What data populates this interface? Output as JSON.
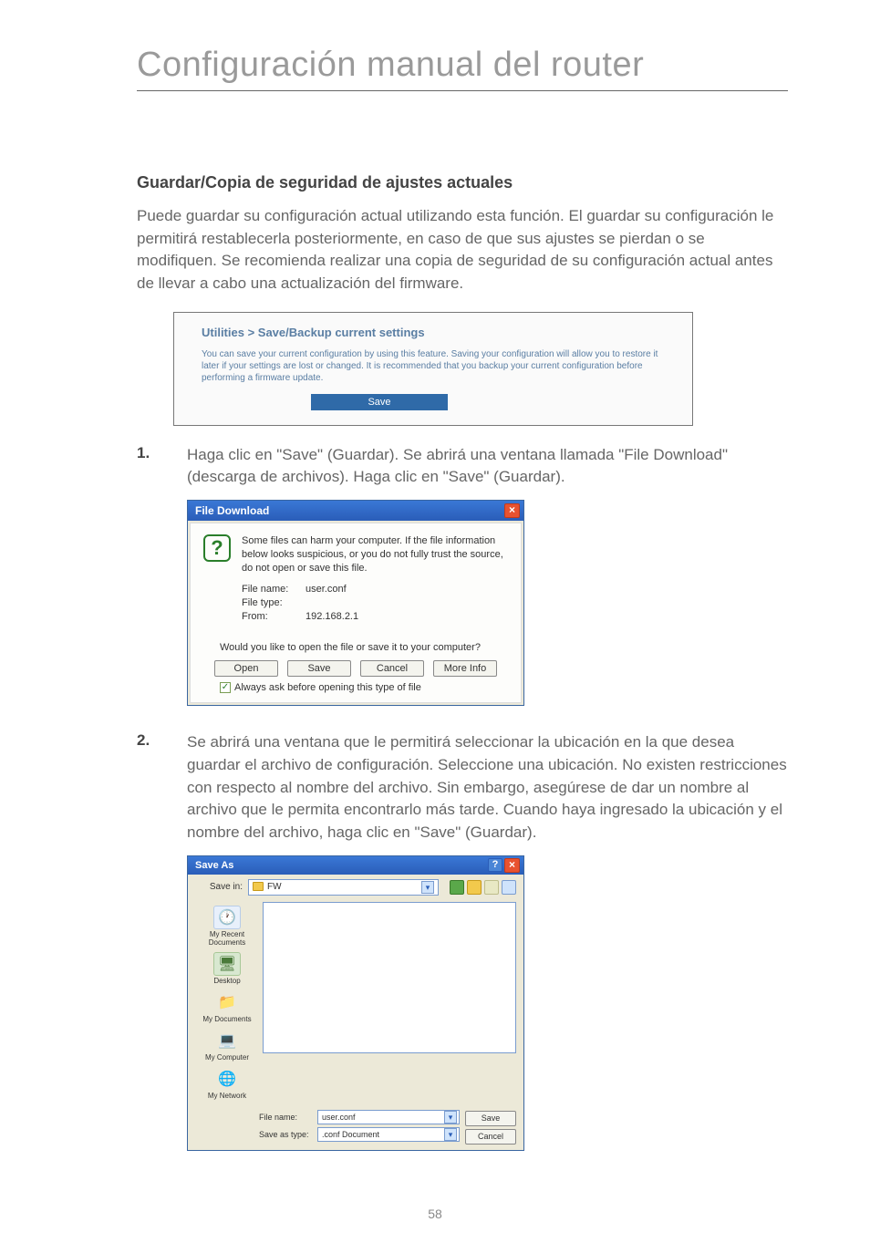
{
  "page_title": "Configuración manual del router",
  "section_heading": "Guardar/Copia de seguridad de ajustes actuales",
  "intro_text": "Puede guardar su configuración actual utilizando esta función. El guardar su configuración le permitirá restablecerla posteriormente, en caso de que sus ajustes se pierdan o se modifiquen. Se recomienda realizar una copia de seguridad de su configuración actual antes de llevar a cabo una actualización del firmware.",
  "router_panel": {
    "title": "Utilities > Save/Backup current settings",
    "description": "You can save your current configuration by using this feature. Saving your configuration will allow you to restore it later if your settings are lost or changed. It is recommended that you backup your current configuration before performing a firmware update.",
    "save_label": "Save"
  },
  "step1": {
    "num": "1.",
    "text": "Haga clic en \"Save\" (Guardar). Se abrirá una ventana llamada \"File Download\" (descarga de archivos). Haga clic en \"Save\" (Guardar)."
  },
  "file_download": {
    "title": "File Download",
    "message": "Some files can harm your computer. If the file information below looks suspicious, or you do not fully trust the source, do not open or save this file.",
    "filename_label": "File name:",
    "filename_value": "user.conf",
    "filetype_label": "File type:",
    "filetype_value": "",
    "from_label": "From:",
    "from_value": "192.168.2.1",
    "prompt": "Would you like to open the file or save it to your computer?",
    "open_label": "Open",
    "save_label": "Save",
    "cancel_label": "Cancel",
    "moreinfo_label": "More Info",
    "checkbox_label": "Always ask before opening this type of file"
  },
  "step2": {
    "num": "2.",
    "text": "Se abrirá una ventana que le permitirá seleccionar la ubicación en la que desea guardar el archivo de configuración. Seleccione una ubicación. No existen restricciones con respecto al nombre del archivo. Sin embargo, asegúrese de dar un nombre al archivo que le permita encontrarlo más tarde. Cuando haya ingresado la ubicación y el nombre del archivo, haga clic en \"Save\" (Guardar)."
  },
  "save_as": {
    "title": "Save As",
    "savein_label": "Save in:",
    "savein_value": "FW",
    "sidebar": {
      "recent": "My Recent Documents",
      "desktop": "Desktop",
      "mydocs": "My Documents",
      "mycomp": "My Computer",
      "mynet": "My Network"
    },
    "filename_label": "File name:",
    "filename_value": "user.conf",
    "savetype_label": "Save as type:",
    "savetype_value": ".conf Document",
    "save_btn": "Save",
    "cancel_btn": "Cancel"
  },
  "page_number": "58"
}
